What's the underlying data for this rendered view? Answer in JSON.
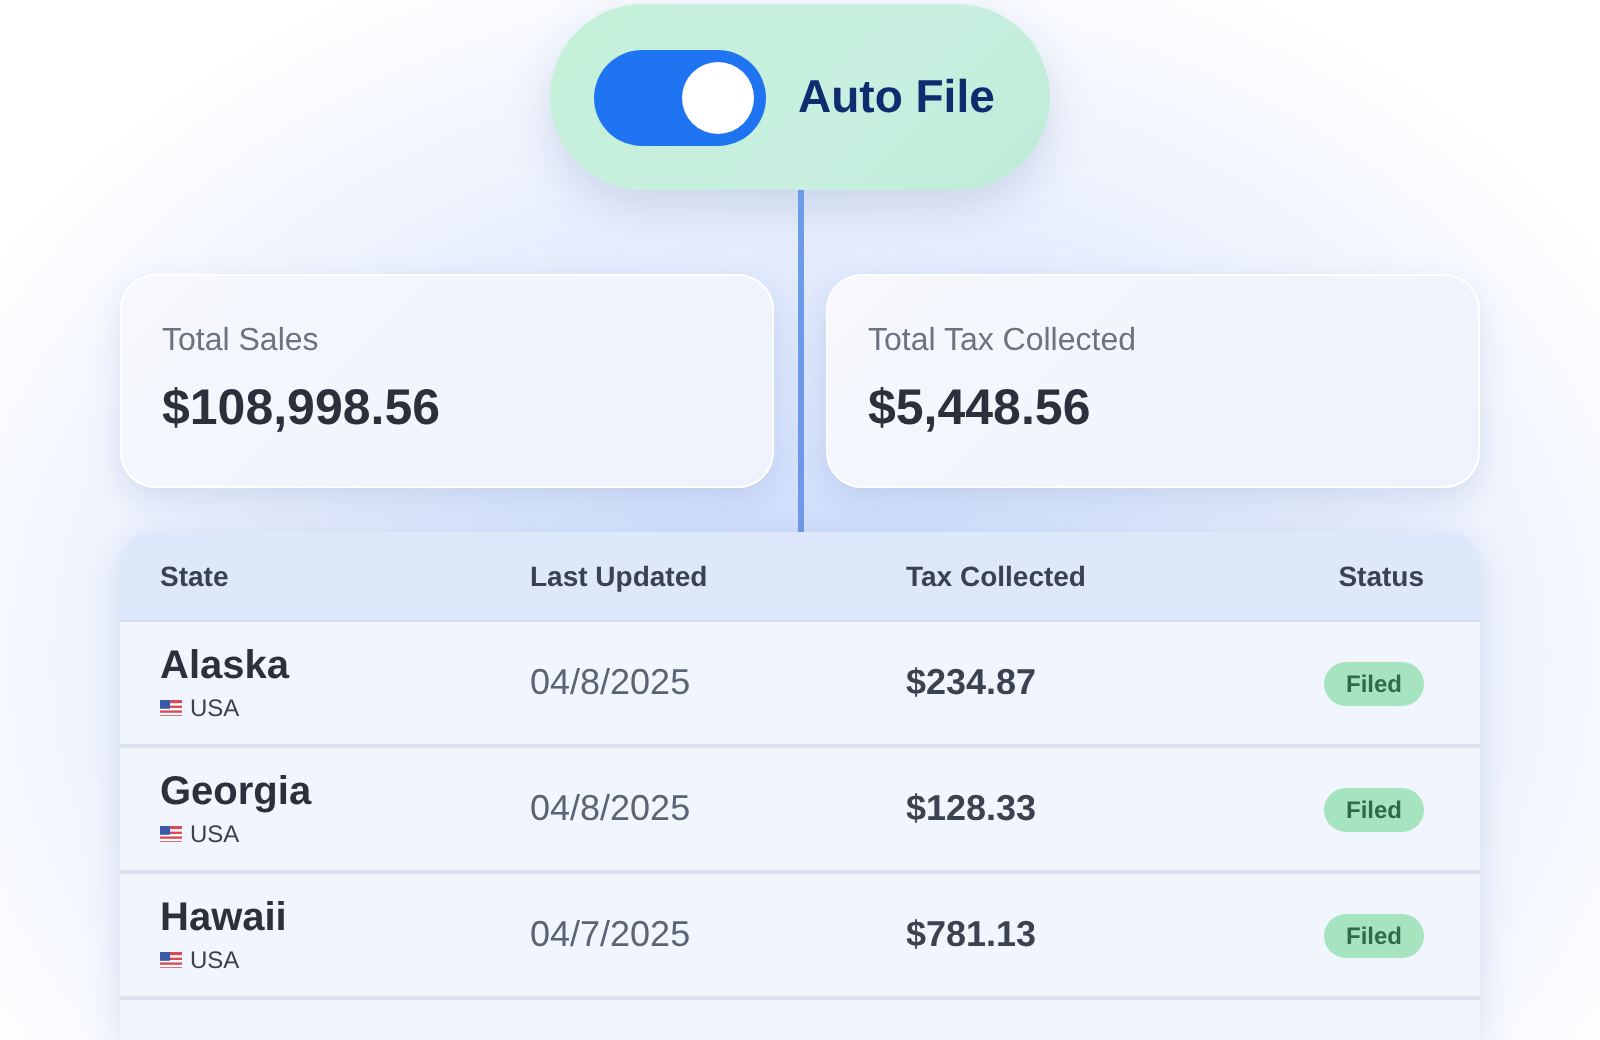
{
  "auto_file": {
    "label": "Auto File",
    "on": true
  },
  "summary_cards": [
    {
      "label": "Total Sales",
      "value": "$108,998.56"
    },
    {
      "label": "Total Tax Collected",
      "value": "$5,448.56"
    }
  ],
  "table": {
    "columns": [
      "State",
      "Last Updated",
      "Tax Collected",
      "Status"
    ],
    "rows": [
      {
        "state": "Alaska",
        "country": "USA",
        "last_updated": "04/8/2025",
        "tax_collected": "$234.87",
        "status": "Filed"
      },
      {
        "state": "Georgia",
        "country": "USA",
        "last_updated": "04/8/2025",
        "tax_collected": "$128.33",
        "status": "Filed"
      },
      {
        "state": "Hawaii",
        "country": "USA",
        "last_updated": "04/7/2025",
        "tax_collected": "$781.13",
        "status": "Filed"
      }
    ]
  }
}
